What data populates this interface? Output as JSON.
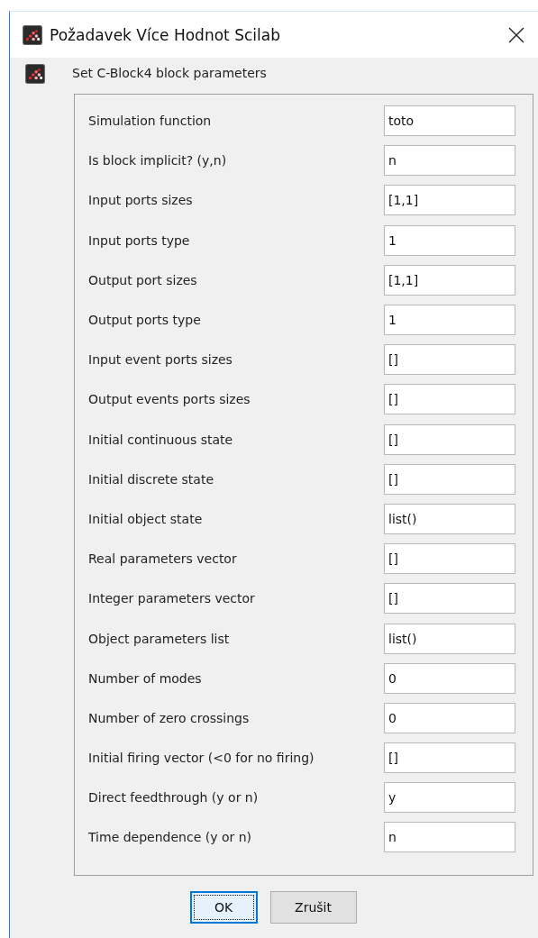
{
  "window": {
    "title": "Požadavek Více Hodnot Scilab"
  },
  "header": "Set C-Block4 block parameters",
  "fields": [
    {
      "label": "Simulation function",
      "value": "toto"
    },
    {
      "label": "Is block implicit? (y,n)",
      "value": "n"
    },
    {
      "label": "Input ports sizes",
      "value": "[1,1]"
    },
    {
      "label": "Input ports type",
      "value": "1"
    },
    {
      "label": "Output port sizes",
      "value": "[1,1]"
    },
    {
      "label": "Output ports type",
      "value": "1"
    },
    {
      "label": "Input event ports sizes",
      "value": "[]"
    },
    {
      "label": "Output events ports sizes",
      "value": "[]"
    },
    {
      "label": "Initial continuous state",
      "value": "[]"
    },
    {
      "label": "Initial discrete state",
      "value": "[]"
    },
    {
      "label": "Initial object state",
      "value": "list()"
    },
    {
      "label": "Real parameters vector",
      "value": "[]"
    },
    {
      "label": "Integer parameters vector",
      "value": "[]"
    },
    {
      "label": "Object parameters list",
      "value": "list()"
    },
    {
      "label": "Number of modes",
      "value": "0"
    },
    {
      "label": "Number of zero crossings",
      "value": "0"
    },
    {
      "label": "Initial firing vector (<0 for no firing)",
      "value": "[]"
    },
    {
      "label": "Direct feedthrough (y or n)",
      "value": "y"
    },
    {
      "label": "Time dependence (y or n)",
      "value": "n"
    }
  ],
  "buttons": [
    {
      "label": "OK",
      "focused": true
    },
    {
      "label": "Zrušit",
      "focused": false
    }
  ]
}
